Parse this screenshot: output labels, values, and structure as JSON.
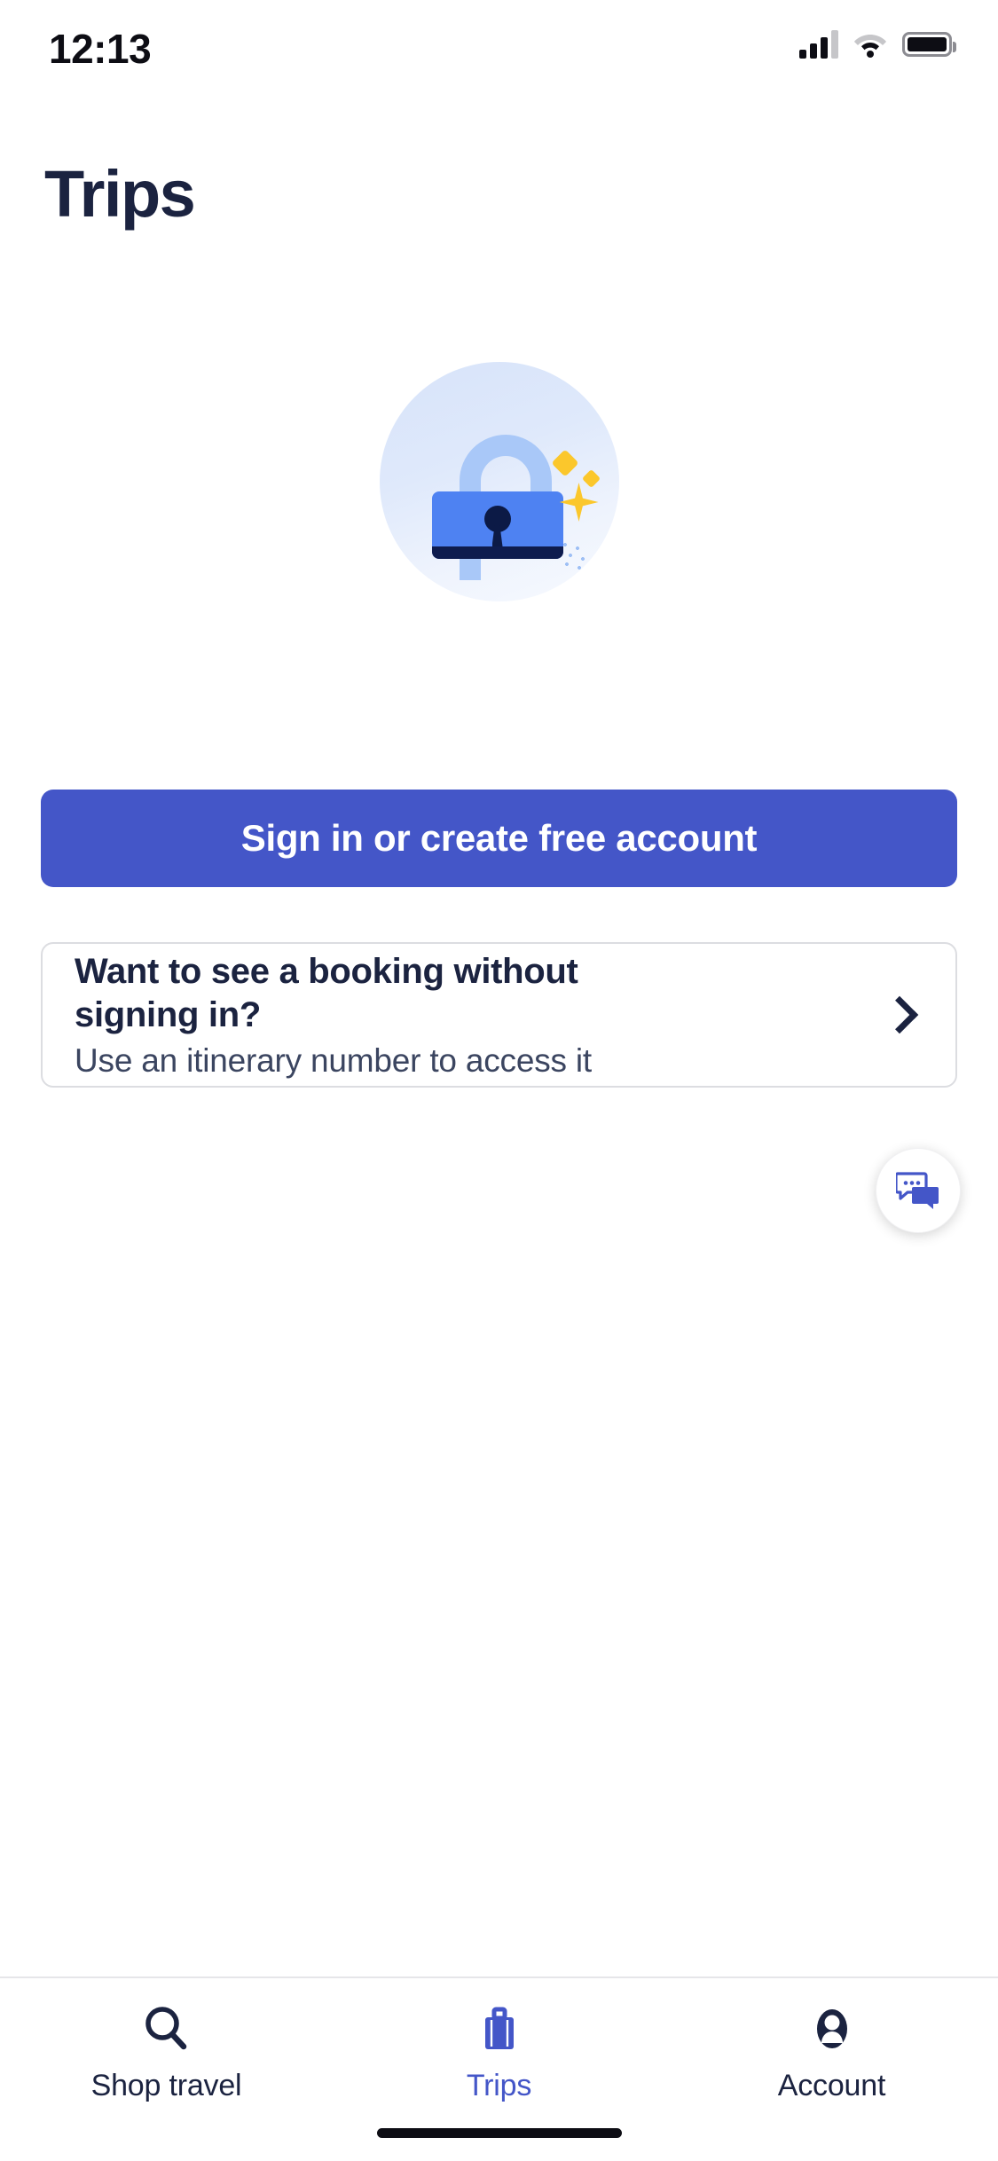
{
  "status_bar": {
    "time": "12:13",
    "cellular_icon": "cellular-signal-icon",
    "wifi_icon": "wifi-icon",
    "battery_icon": "battery-icon",
    "signal_bars_filled": 3,
    "signal_bars_total": 4
  },
  "header": {
    "title": "Trips"
  },
  "illustration": {
    "name": "unlocked-padlock-illustration",
    "circle_color": "#dfe9fb",
    "shackle_color": "#a9c8f8",
    "body_color": "#4e82f2",
    "base_color": "#0e1c4e",
    "sparkle_color": "#fbc72c"
  },
  "main": {
    "sign_in_button": {
      "label": "Sign in or create free account",
      "background": "#4456c8",
      "text_color": "#ffffff"
    },
    "itinerary_card": {
      "title": "Want to see a booking without signing in?",
      "subtitle": "Use an itinerary number to access it",
      "chevron_icon": "chevron-right-icon"
    }
  },
  "chat_fab": {
    "icon": "chat-bubbles-icon",
    "color": "#4456c8"
  },
  "tab_bar": {
    "active_color": "#4456c8",
    "inactive_color": "#1b2340",
    "items": [
      {
        "label": "Shop travel",
        "icon": "search-icon",
        "active": false
      },
      {
        "label": "Trips",
        "icon": "briefcase-icon",
        "active": true
      },
      {
        "label": "Account",
        "icon": "person-icon",
        "active": false
      }
    ]
  }
}
